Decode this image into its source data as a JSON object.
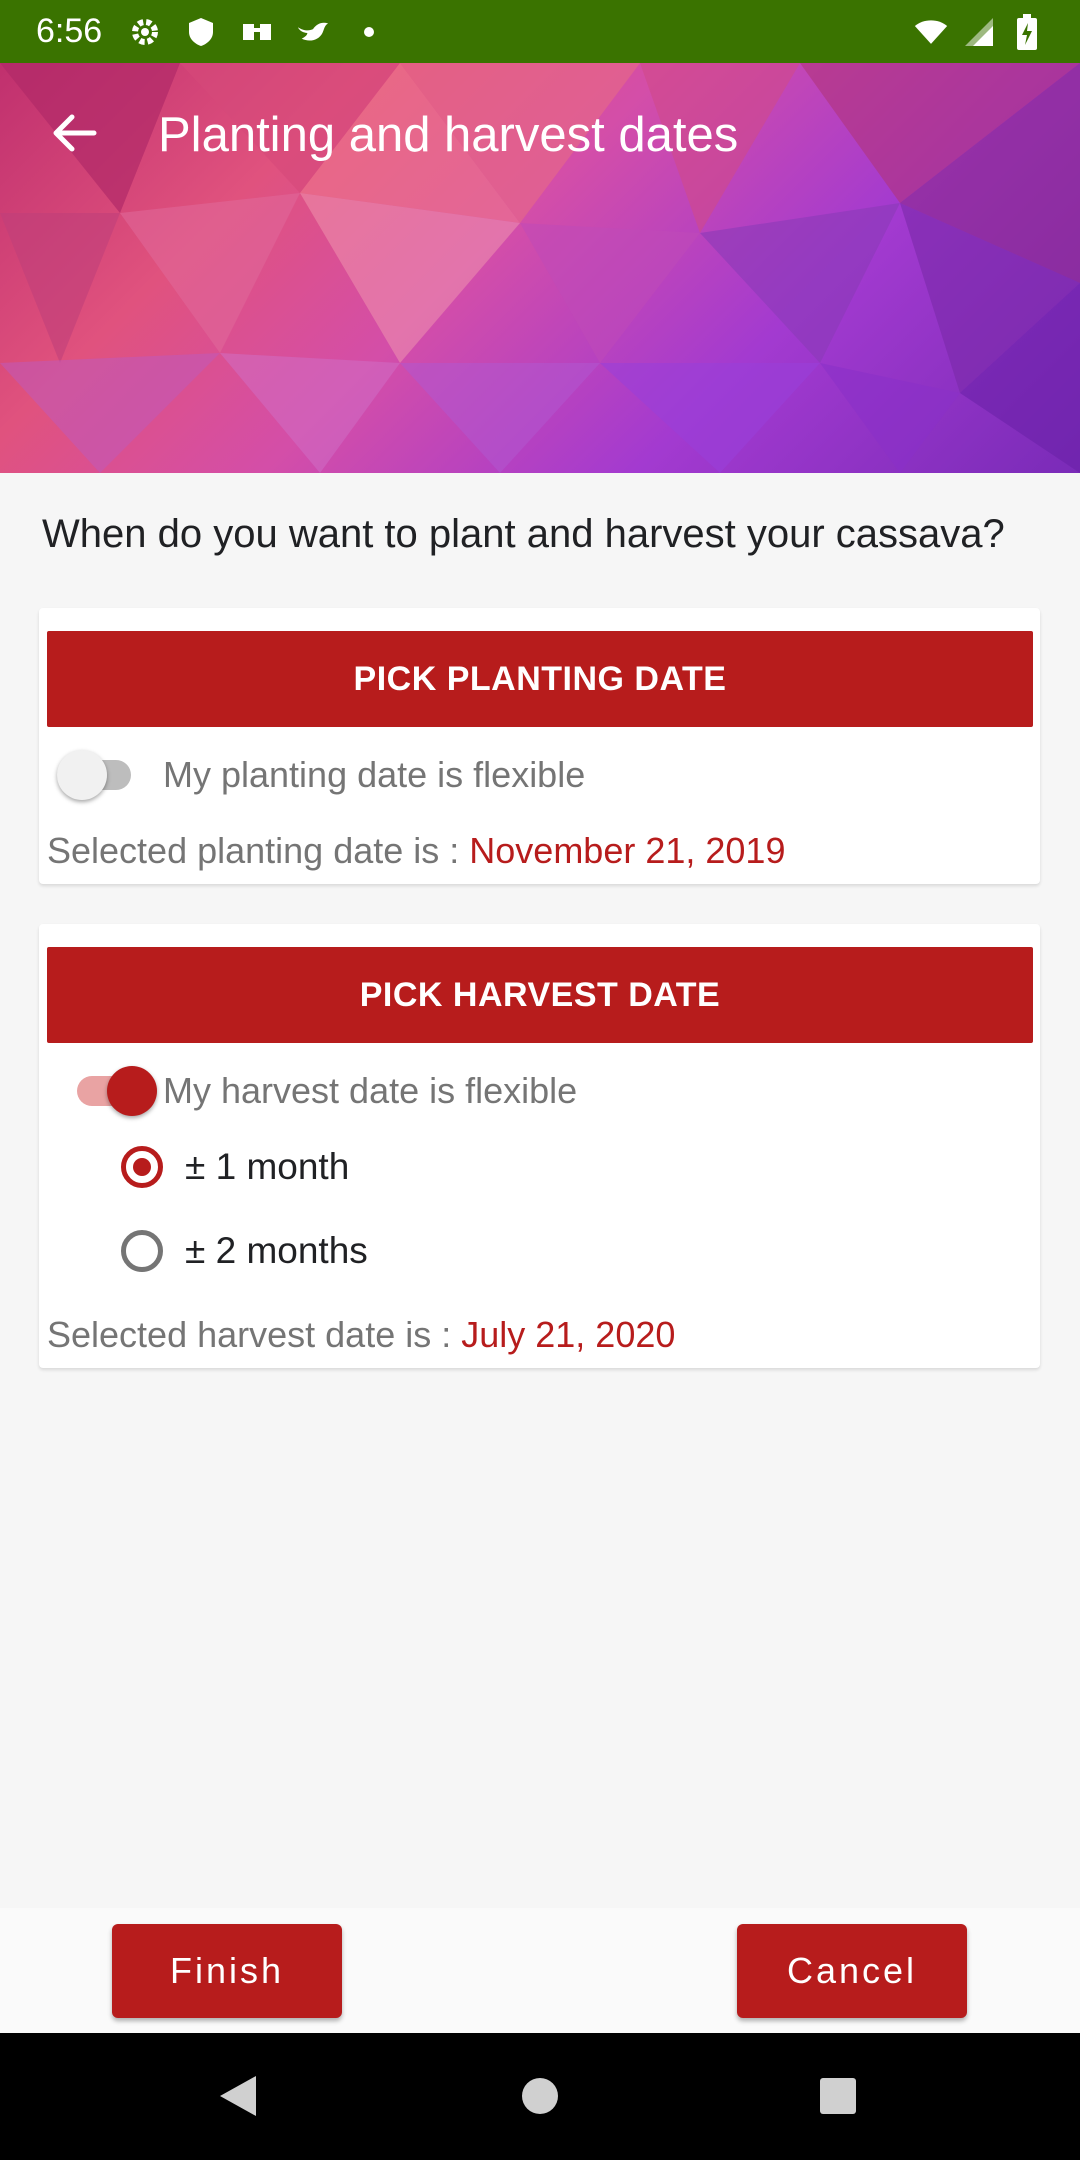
{
  "status_bar": {
    "time": "6:56",
    "left_icons": [
      "gear-icon",
      "shield-icon",
      "app-icon",
      "bird-icon",
      "dot-icon"
    ],
    "right_icons": [
      "wifi-icon",
      "signal-icon",
      "battery-charging-icon"
    ]
  },
  "header": {
    "title": "Planting and harvest dates",
    "back_icon": "arrow-back-icon"
  },
  "question": "When do you want to plant and harvest your cassava?",
  "planting": {
    "button_label": "PICK PLANTING DATE",
    "flexible_label": "My planting date is flexible",
    "flexible_on": false,
    "selected_prefix": "Selected planting date is : ",
    "selected_date": "November 21, 2019"
  },
  "harvest": {
    "button_label": "PICK HARVEST DATE",
    "flexible_label": "My harvest date is flexible",
    "flexible_on": true,
    "options": [
      {
        "label": "± 1 month",
        "checked": true
      },
      {
        "label": "± 2 months",
        "checked": false
      }
    ],
    "selected_prefix": "Selected harvest date is : ",
    "selected_date": "July 21, 2020"
  },
  "actions": {
    "finish_label": "Finish",
    "cancel_label": "Cancel"
  },
  "colors": {
    "accent": "#b71c1c",
    "status_bar": "#3a7300"
  }
}
